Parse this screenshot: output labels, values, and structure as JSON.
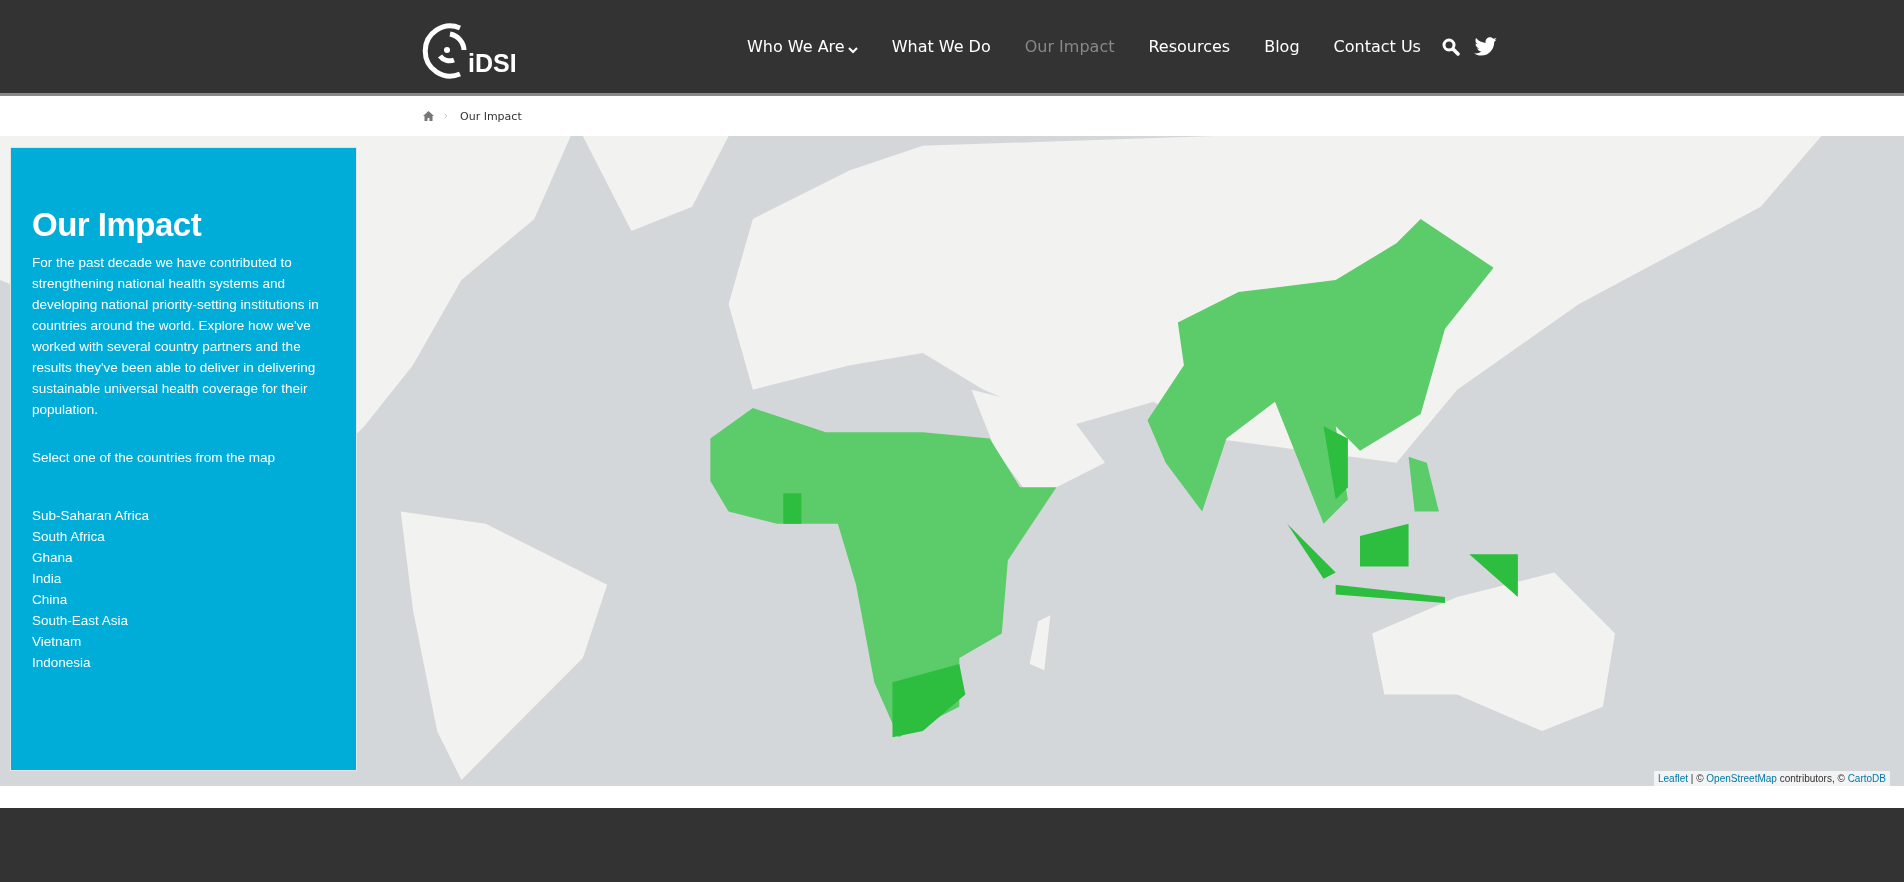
{
  "header": {
    "logo_text": "iDSI",
    "nav": [
      {
        "label": "Who We Are",
        "selected": false,
        "has_submenu": true
      },
      {
        "label": "What We Do",
        "selected": false,
        "has_submenu": false
      },
      {
        "label": "Our Impact",
        "selected": true,
        "has_submenu": false
      },
      {
        "label": "Resources",
        "selected": false,
        "has_submenu": false
      },
      {
        "label": "Blog",
        "selected": false,
        "has_submenu": false
      },
      {
        "label": "Contact Us",
        "selected": false,
        "has_submenu": false
      }
    ]
  },
  "breadcrumb": {
    "current": "Our Impact"
  },
  "panel": {
    "title": "Our Impact",
    "intro": "For the past decade we have contributed to strengthening national health systems and developing national priority-setting institutions in countries around the world. Explore how we've worked with several country partners and the results they've been able to deliver in delivering sustainable universal health coverage for their population.",
    "prompt": "Select one of the countries from the map",
    "countries": [
      "Sub-Saharan Africa",
      "South Africa",
      "Ghana",
      "India",
      "China",
      "South-East Asia",
      "Vietnam",
      "Indonesia"
    ]
  },
  "map_attribution": [
    {
      "kind": "link",
      "text": "Leaflet"
    },
    {
      "kind": "text",
      "text": " | © "
    },
    {
      "kind": "link",
      "text": "OpenStreetMap"
    },
    {
      "kind": "text",
      "text": " contributors, © "
    },
    {
      "kind": "link",
      "text": "CartoDB"
    }
  ]
}
